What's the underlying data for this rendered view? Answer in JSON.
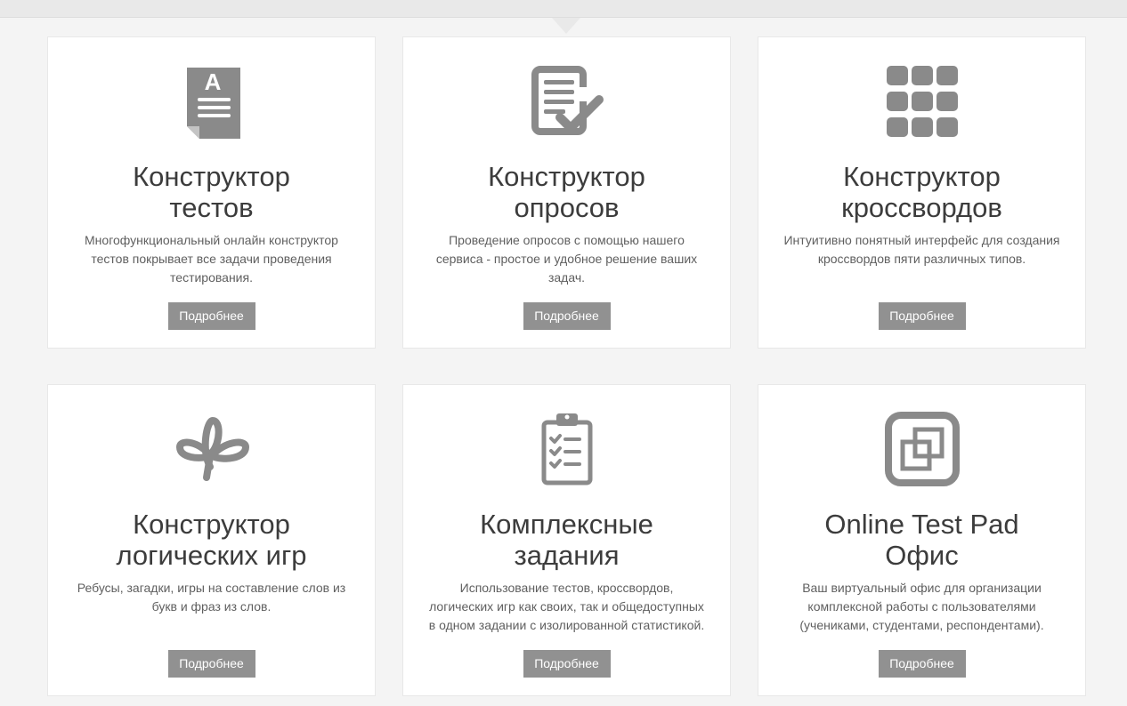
{
  "cards": [
    {
      "icon": "test-document-icon",
      "title_line1": "Конструктор",
      "title_line2": "тестов",
      "description": "Многофункциональный онлайн конструктор тестов покрывает все задачи проведения тестирования.",
      "button_label": "Подробнее"
    },
    {
      "icon": "survey-checkmark-icon",
      "title_line1": "Конструктор",
      "title_line2": "опросов",
      "description": "Проведение опросов с помощью нашего сервиса - простое и удобное решение ваших задач.",
      "button_label": "Подробнее"
    },
    {
      "icon": "crossword-grid-icon",
      "title_line1": "Конструктор",
      "title_line2": "кроссвордов",
      "description": "Интуитивно понятный интерфейс для создания кроссвордов пяти различных типов.",
      "button_label": "Подробнее"
    },
    {
      "icon": "logic-games-loops-icon",
      "title_line1": "Конструктор",
      "title_line2": "логических игр",
      "description": "Ребусы, загадки, игры на составление слов из букв и фраз из слов.",
      "button_label": "Подробнее"
    },
    {
      "icon": "clipboard-checklist-icon",
      "title_line1": "Комплексные",
      "title_line2": "задания",
      "description": "Использование тестов, кроссвордов, логических игр как своих, так и общедоступных в одном задании с изолированной статистикой.",
      "button_label": "Подробнее"
    },
    {
      "icon": "office-windows-icon",
      "title_line1": "Online Test Pad",
      "title_line2": "Офис",
      "description": "Ваш виртуальный офис для организации комплексной работы с пользователями (учениками, студентами, респондентами).",
      "button_label": "Подробнее"
    }
  ],
  "colors": {
    "page_background": "#f4f4f4",
    "card_background": "#ffffff",
    "icon_gray": "#8a8a8a",
    "button_gray": "#919191",
    "title_text": "#3c3c3c",
    "description_text": "#5f5f5f"
  }
}
